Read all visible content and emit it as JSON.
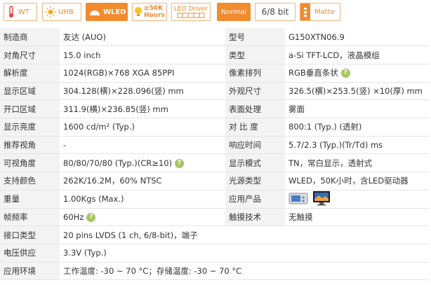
{
  "badges": [
    {
      "text": "WT",
      "icon": "thermometer-icon"
    },
    {
      "text": "UHB",
      "icon": "sun-icon"
    },
    {
      "text": "WLED",
      "icon": "led-icon"
    },
    {
      "text": "≥50K",
      "text2": "Hours",
      "icon": "bulb-icon"
    },
    {
      "text": "LED Driver",
      "icon": "led-driver-icon"
    },
    {
      "text": "Normal"
    },
    {
      "text": "6/8 bit"
    },
    {
      "text": "Matte",
      "icon": "matte-icon"
    }
  ],
  "rows": [
    {
      "l1": "制造商",
      "v1": "友达 (AUO)",
      "l2": "型号",
      "v2": "G150XTN06.9"
    },
    {
      "l1": "对角尺寸",
      "v1": "15.0 inch",
      "l2": "类型",
      "v2": "a-Si TFT-LCD，液晶模组"
    },
    {
      "l1": "解析度",
      "v1": "1024(RGB)×768   XGA   85PPI",
      "l2": "像素排列",
      "v2": "RGB垂直条状"
    },
    {
      "l1": "显示区域",
      "v1": "304.128(横)×228.096(竖) mm",
      "l2": "外观尺寸",
      "v2": "326.5(横)×253.5(竖) ×10(厚) mm"
    },
    {
      "l1": "开口区域",
      "v1": "311.9(横)×236.85(竖) mm",
      "l2": "表面处理",
      "v2": "雾面"
    },
    {
      "l1": "显示亮度",
      "v1": "1600 cd/m² (Typ.)",
      "l2": "对 比 度",
      "v2": "800:1 (Typ.) (透射)"
    },
    {
      "l1": "推荐视角",
      "v1": "-",
      "l2": "响应时间",
      "v2": "5.7/2.3 (Typ.)(Tr/Td) ms"
    },
    {
      "l1": "可视角度",
      "v1": "80/80/70/80 (Typ.)(CR≥10)",
      "l2": "显示模式",
      "v2": "TN，常白显示，透射式"
    },
    {
      "l1": "支持颜色",
      "v1": "262K/16.2M，60% NTSC",
      "l2": "光源类型",
      "v2": "WLED，50K小时，含LED驱动器"
    },
    {
      "l1": "重量",
      "v1": "1.00Kgs (Max.)",
      "l2": "应用产品",
      "v2": ""
    },
    {
      "l1": "帧频率",
      "v1": "60Hz",
      "l2": "触摸技术",
      "v2": "无触摸"
    },
    {
      "l1": "接口类型",
      "v1": "20 pins   LVDS (1 ch, 6/8-bit)，端子"
    },
    {
      "l1": "电压供应",
      "v1": "3.3V (Typ.)"
    },
    {
      "l1": "应用环境",
      "v1": "工作温度: -30 ~ 70 °C；存储温度: -30 ~ 70 °C"
    }
  ],
  "help_icon": "question-icon",
  "help_glyph": "?",
  "colors": {
    "accent": "#f28a2e",
    "help": "#a4c760"
  }
}
